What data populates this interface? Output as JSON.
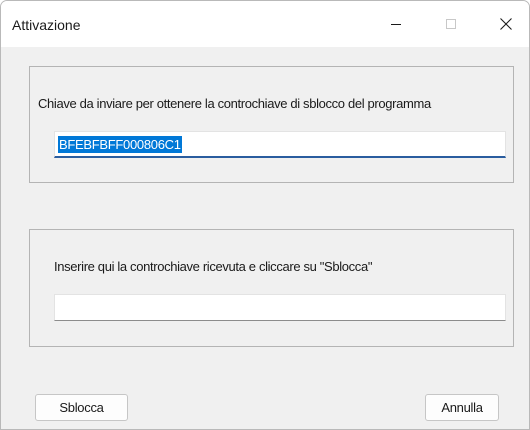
{
  "window": {
    "title": "Attivazione",
    "controls": {
      "minimize_icon": "minimize-icon",
      "maximize_icon": "maximize-icon",
      "close_icon": "close-icon"
    }
  },
  "request_group": {
    "label": "Chiave da inviare per ottenere la controchiave di sblocco del programma",
    "key_value": "BFEBFBFF000806C1"
  },
  "unlock_group": {
    "label": "Inserire qui la controchiave ricevuta e cliccare su \"Sblocca\"",
    "input_value": ""
  },
  "buttons": {
    "unlock_label": "Sblocca",
    "cancel_label": "Annulla"
  },
  "colors": {
    "selection": "#0078d7",
    "focus_underline": "#2a5d9f",
    "window_bg": "#f0f0f0"
  }
}
